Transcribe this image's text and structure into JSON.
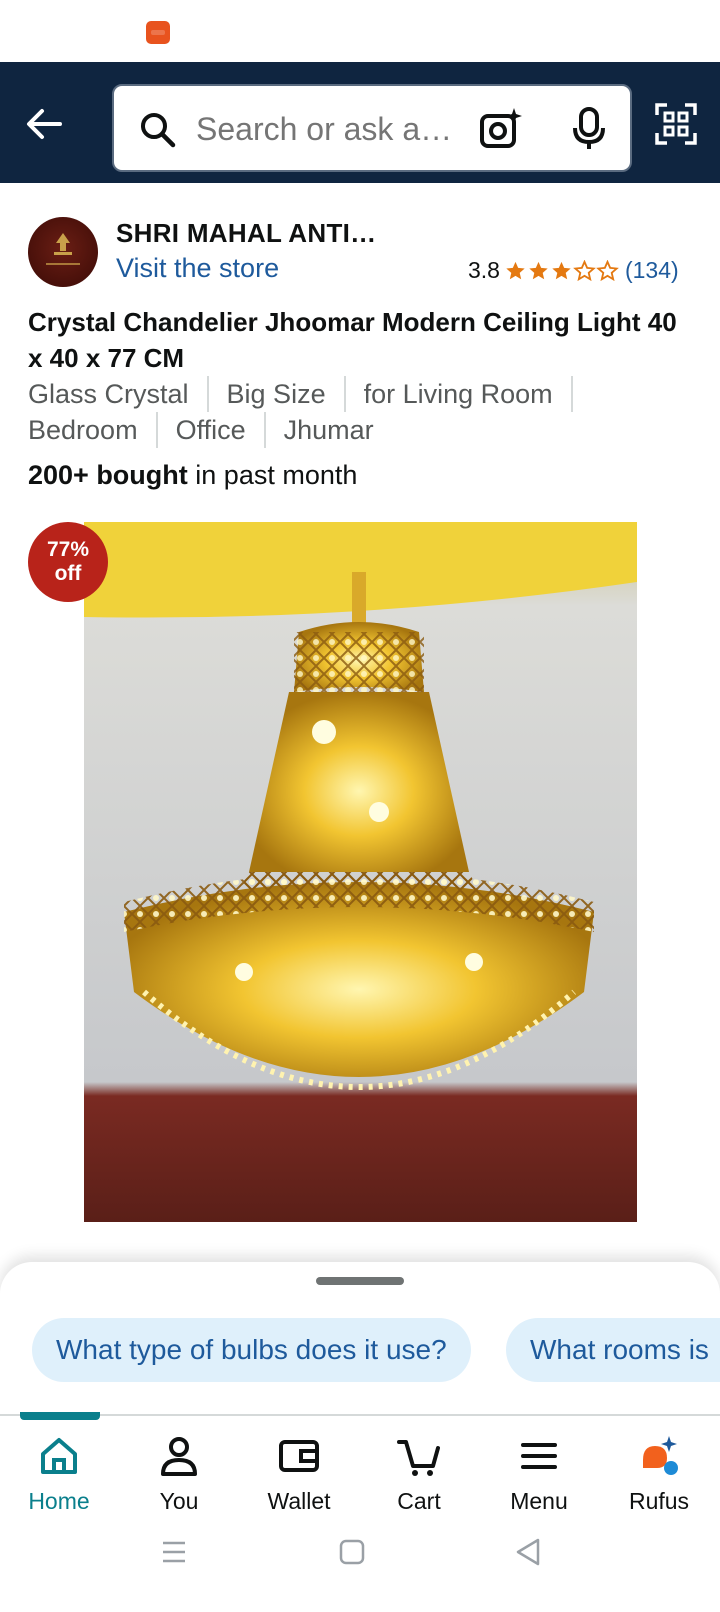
{
  "header": {
    "search_placeholder": "Search or ask a…"
  },
  "store": {
    "name": "SHRI MAHAL ANTI…",
    "visit_label": "Visit the store",
    "rating": "3.8",
    "rating_count": "(134)",
    "stars_filled": 3.8
  },
  "product": {
    "title": "Crystal Chandelier Jhoomar Modern Ceiling Light 40 x 40 x 77 CM",
    "tags": [
      "Glass Crystal",
      "Big Size",
      "for Living Room",
      "Bedroom",
      "Office",
      "Jhumar"
    ],
    "bought_bold": "200+ bought",
    "bought_rest": " in past month",
    "discount_pct": "77%",
    "discount_off": "off"
  },
  "rufus_chips": [
    "What type of bulbs does it use?",
    "What rooms is"
  ],
  "bottom_nav": {
    "items": [
      {
        "label": "Home",
        "icon": "home-icon"
      },
      {
        "label": "You",
        "icon": "person-icon"
      },
      {
        "label": "Wallet",
        "icon": "wallet-icon"
      },
      {
        "label": "Cart",
        "icon": "cart-icon"
      },
      {
        "label": "Menu",
        "icon": "menu-icon"
      },
      {
        "label": "Rufus",
        "icon": "rufus-icon"
      }
    ],
    "active": "Home"
  },
  "colors": {
    "header_bg": "#0f2540",
    "link": "#1e5a9c",
    "star": "#e47911",
    "active_tab": "#0a7f8c",
    "discount_badge": "#b8231a"
  }
}
